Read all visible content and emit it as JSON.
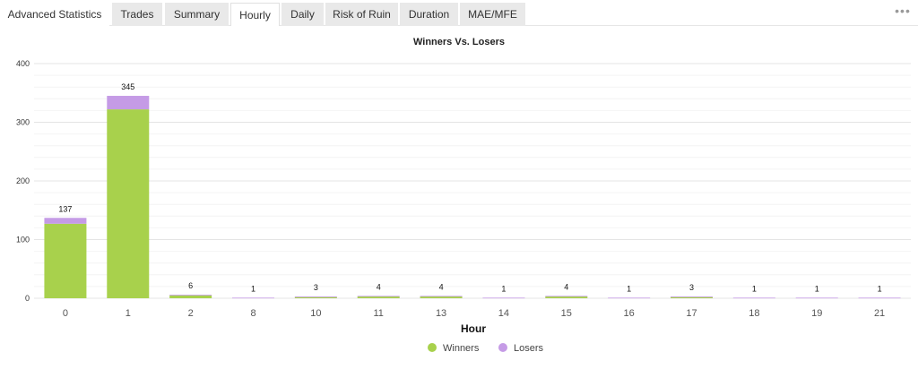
{
  "tabs": [
    {
      "label": "Advanced Statistics",
      "state": "title"
    },
    {
      "label": "Trades",
      "state": "inactive"
    },
    {
      "label": "Summary",
      "state": "inactive"
    },
    {
      "label": "Hourly",
      "state": "active"
    },
    {
      "label": "Daily",
      "state": "inactive"
    },
    {
      "label": "Risk of Ruin",
      "state": "inactive"
    },
    {
      "label": "Duration",
      "state": "inactive"
    },
    {
      "label": "MAE/MFE",
      "state": "inactive"
    }
  ],
  "more_icon": "more-dots-icon",
  "colors": {
    "winners": "#a8d14c",
    "losers": "#c59be6",
    "grid": "#ececec"
  },
  "chart_data": {
    "type": "bar",
    "stacked": true,
    "title": "Winners Vs. Losers",
    "xlabel": "Hour",
    "ylabel": "",
    "ylim": [
      0,
      400
    ],
    "yticks": [
      0,
      100,
      200,
      300,
      400
    ],
    "categories": [
      "0",
      "1",
      "2",
      "8",
      "10",
      "11",
      "13",
      "14",
      "15",
      "16",
      "17",
      "18",
      "19",
      "21"
    ],
    "series": [
      {
        "name": "Winners",
        "values": [
          127,
          322,
          5,
          0,
          2,
          3,
          3,
          0,
          3,
          0,
          2,
          0,
          0,
          0
        ]
      },
      {
        "name": "Losers",
        "values": [
          10,
          23,
          1,
          1,
          1,
          1,
          1,
          1,
          1,
          1,
          1,
          1,
          1,
          1
        ]
      }
    ],
    "totals": [
      137,
      345,
      6,
      1,
      3,
      4,
      4,
      1,
      4,
      1,
      3,
      1,
      1,
      1
    ],
    "legend_position": "bottom-center",
    "grid": true
  }
}
